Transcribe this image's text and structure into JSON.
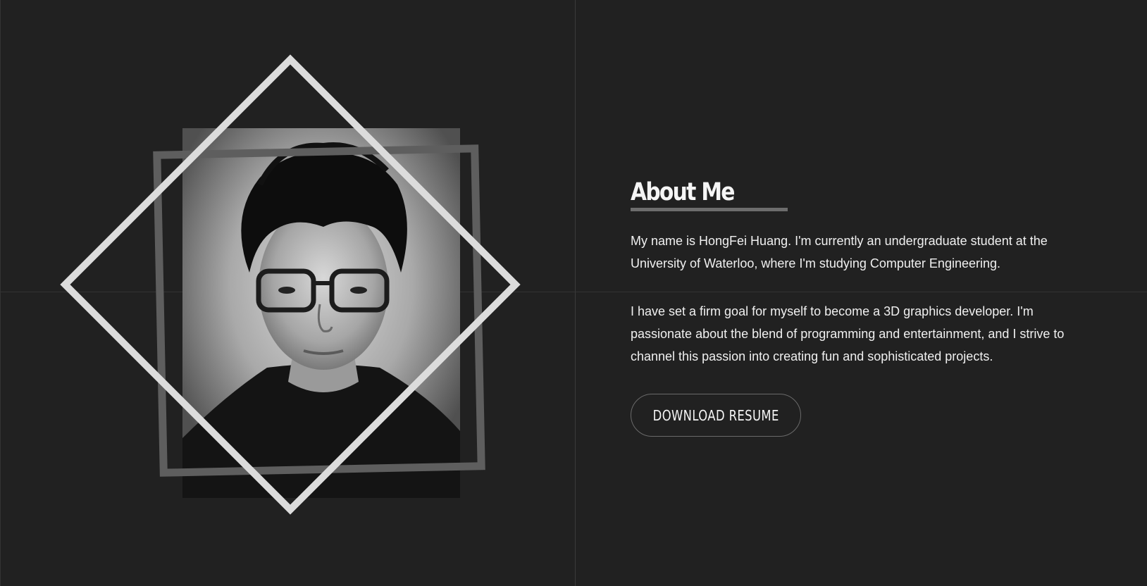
{
  "about": {
    "title": "About Me",
    "paragraphs": [
      "My name is HongFei Huang. I'm currently an undergraduate student at the University of Waterloo, where I'm studying Computer Engineering.",
      "I have set a firm goal for myself to become a 3D graphics developer. I'm passionate about the blend of programming and entertainment, and I strive to channel this passion into creating fun and sophisticated projects."
    ],
    "resume_button_label": "DOWNLOAD RESUME"
  },
  "colors": {
    "background": "#212121",
    "diamond_frame": "#dcdcdc",
    "square_frame": "#5e5e5e",
    "underline": "#6d6d6d"
  },
  "portrait": {
    "icon": "profile-photo"
  }
}
